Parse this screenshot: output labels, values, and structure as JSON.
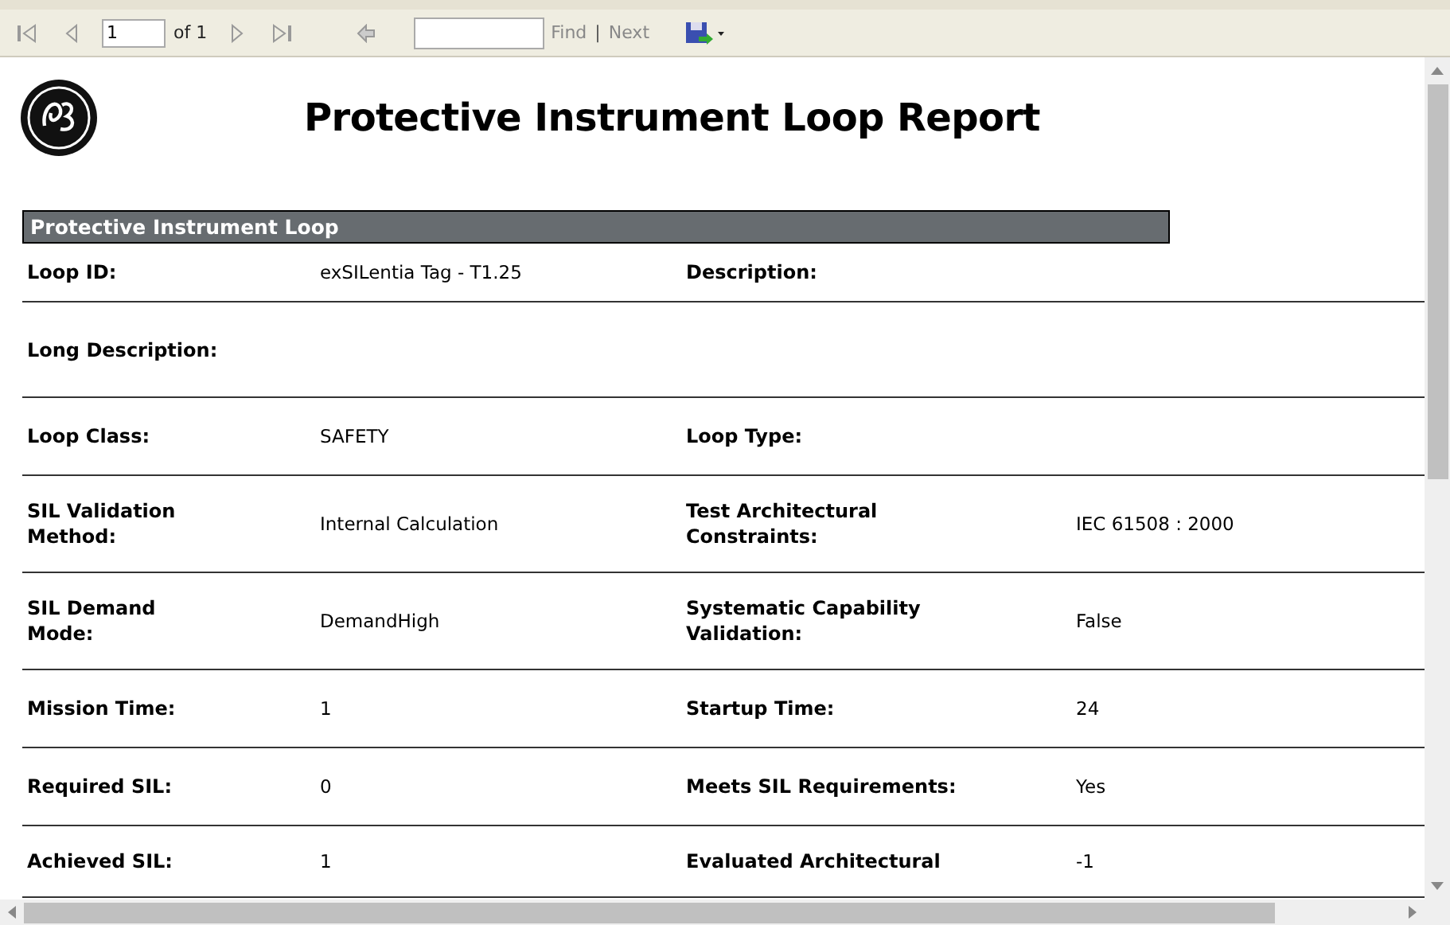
{
  "toolbar": {
    "page": "1",
    "page_count": "of 1",
    "find": "Find",
    "separator": "|",
    "next": "Next"
  },
  "report": {
    "title": "Protective Instrument Loop Report",
    "section": "Protective Instrument Loop",
    "rows": [
      {
        "label": "Loop ID:",
        "value": "exSILentia Tag - T1.25",
        "label2": "Description:"
      },
      {
        "label": "Long Description:"
      },
      {
        "label": "Loop Class:",
        "value": "SAFETY",
        "label2": "Loop Type:"
      },
      {
        "label": "SIL Validation\nMethod:",
        "value": "Internal Calculation",
        "label2": "Test Architectural\nConstraints:",
        "value2": "IEC 61508 : 2000"
      },
      {
        "label": "SIL Demand\nMode:",
        "value": "DemandHigh",
        "label2": "Systematic Capability\nValidation:",
        "value2": "False"
      },
      {
        "label": "Mission Time:",
        "value": "1",
        "label2": "Startup Time:",
        "value2": "24"
      },
      {
        "label": "Required SIL:",
        "value": "0",
        "label2": "Meets SIL Requirements:",
        "value2": "Yes"
      },
      {
        "label": "Achieved SIL:",
        "value": "1",
        "label2": "Evaluated Architectural",
        "value2": "-1"
      }
    ]
  }
}
